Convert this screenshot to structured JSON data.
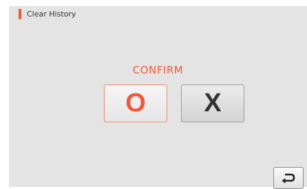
{
  "header": {
    "title": "Clear History",
    "accent_color": "#ef5a3a"
  },
  "dialog": {
    "prompt": "CONFIRM",
    "ok_label": "O",
    "cancel_label": "X"
  },
  "footer": {
    "back_icon": "return-arrow-icon"
  },
  "colors": {
    "background": "#e4e4e4",
    "accent": "#ef5a3a",
    "text": "#333333"
  }
}
